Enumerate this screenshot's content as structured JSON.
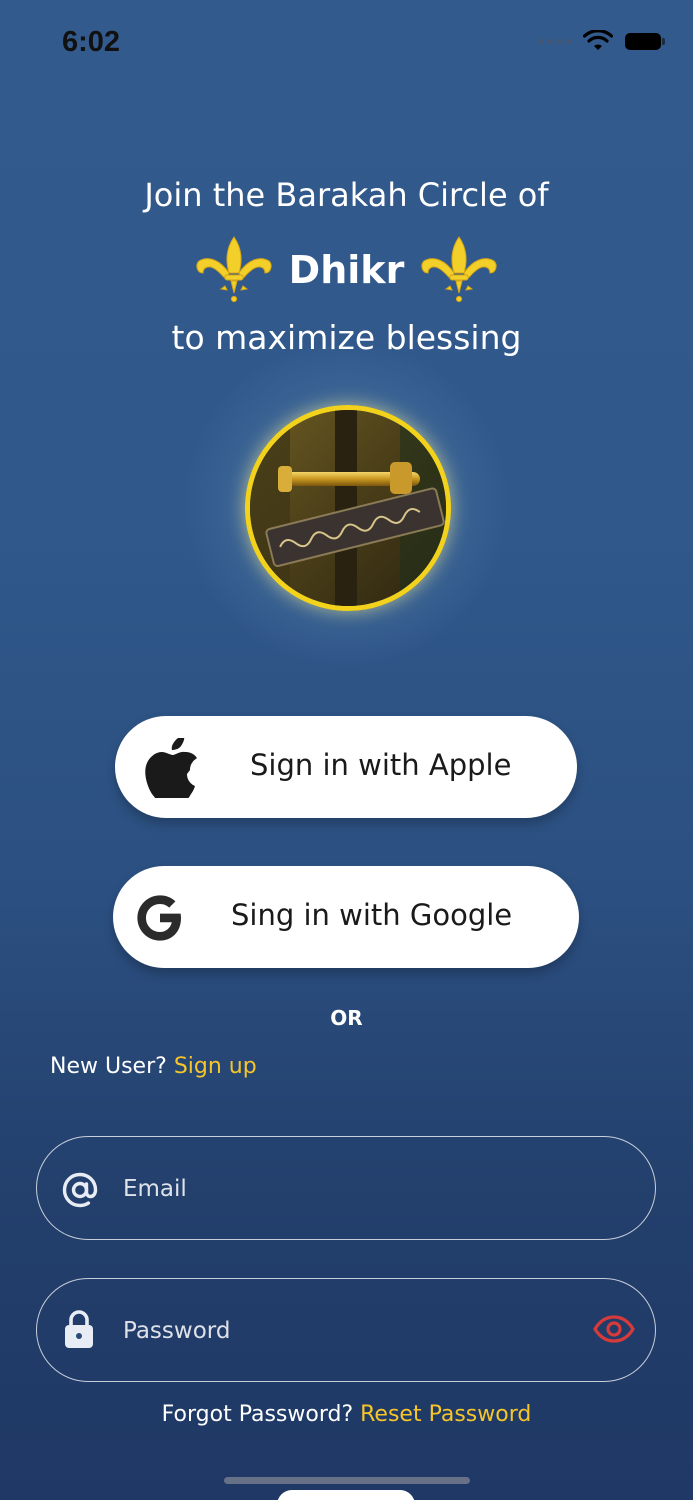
{
  "status_bar": {
    "time": "6:02",
    "icons": [
      "cellular-dots-icon",
      "wifi-icon",
      "battery-icon"
    ]
  },
  "headline": {
    "line1": "Join the Barakah Circle of",
    "highlight": "Dhikr",
    "line3": "to maximize blessing",
    "ornament_icon": "fleur-de-lis-icon",
    "ornament_color": "#f3cf2a"
  },
  "medallion": {
    "border_color": "#f3d21c"
  },
  "auth_buttons": {
    "apple_label": "Sign in with Apple",
    "apple_icon": "apple-icon",
    "google_label": "Sing in with Google",
    "google_icon": "google-icon"
  },
  "divider_text": "OR",
  "signup": {
    "prompt": "New User?",
    "link": "Sign up"
  },
  "email_field": {
    "placeholder": "Email",
    "icon": "at-sign-icon"
  },
  "password_field": {
    "placeholder": "Password",
    "icon": "lock-icon",
    "toggle_icon": "eye-icon",
    "toggle_color": "#d63a3a"
  },
  "forgot": {
    "prompt": "Forgot Password?",
    "link": "Reset Password"
  },
  "colors": {
    "accent_yellow": "#f6c529",
    "background_top": "#335a8c",
    "background_bottom": "#1f3865"
  }
}
